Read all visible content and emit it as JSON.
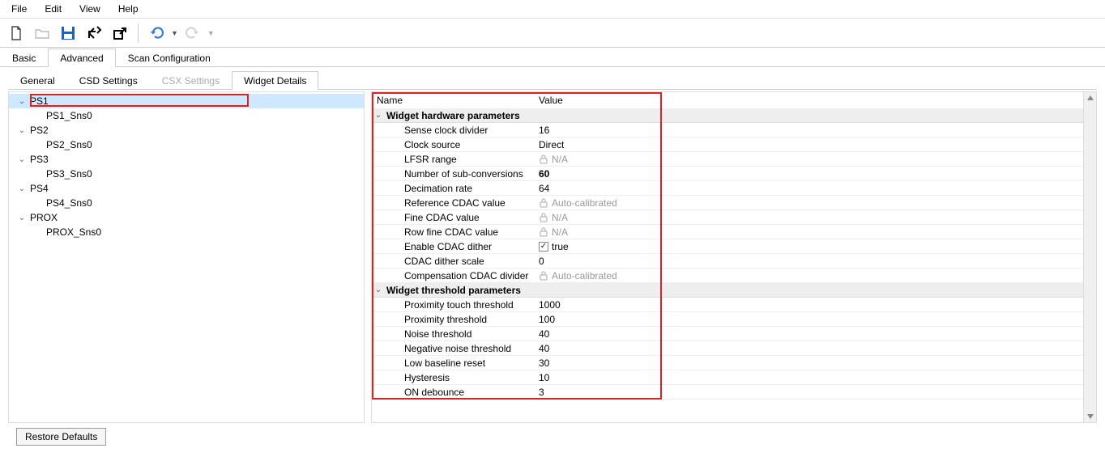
{
  "menu": {
    "file": "File",
    "edit": "Edit",
    "view": "View",
    "help": "Help"
  },
  "tabs1": {
    "basic": "Basic",
    "advanced": "Advanced",
    "scan": "Scan Configuration"
  },
  "tabs2": {
    "general": "General",
    "csd": "CSD Settings",
    "csx": "CSX Settings",
    "widget": "Widget Details"
  },
  "tree": {
    "ps1": "PS1",
    "ps1s": "PS1_Sns0",
    "ps2": "PS2",
    "ps2s": "PS2_Sns0",
    "ps3": "PS3",
    "ps3s": "PS3_Sns0",
    "ps4": "PS4",
    "ps4s": "PS4_Sns0",
    "prox": "PROX",
    "proxs": "PROX_Sns0"
  },
  "propHeader": {
    "name": "Name",
    "value": "Value"
  },
  "groups": {
    "hw": "Widget hardware parameters",
    "th": "Widget threshold parameters"
  },
  "hw": {
    "senseClockDivider": {
      "name": "Sense clock divider",
      "value": "16"
    },
    "clockSource": {
      "name": "Clock source",
      "value": "Direct"
    },
    "lfsrRange": {
      "name": "LFSR range",
      "value": "N/A"
    },
    "numSubConv": {
      "name": "Number of sub-conversions",
      "value": "60"
    },
    "decimationRate": {
      "name": "Decimation rate",
      "value": "64"
    },
    "refCdac": {
      "name": "Reference CDAC value",
      "value": "Auto-calibrated"
    },
    "fineCdac": {
      "name": "Fine CDAC value",
      "value": "N/A"
    },
    "rowFineCdac": {
      "name": "Row fine CDAC value",
      "value": "N/A"
    },
    "enableDither": {
      "name": "Enable CDAC dither",
      "value": "true"
    },
    "ditherScale": {
      "name": "CDAC dither scale",
      "value": "0"
    },
    "compDivider": {
      "name": "Compensation CDAC divider",
      "value": "Auto-calibrated"
    }
  },
  "th": {
    "proxTouch": {
      "name": "Proximity touch threshold",
      "value": "1000"
    },
    "prox": {
      "name": "Proximity threshold",
      "value": "100"
    },
    "noise": {
      "name": "Noise threshold",
      "value": "40"
    },
    "negNoise": {
      "name": "Negative noise threshold",
      "value": "40"
    },
    "lowBaseline": {
      "name": "Low baseline reset",
      "value": "30"
    },
    "hysteresis": {
      "name": "Hysteresis",
      "value": "10"
    },
    "onDebounce": {
      "name": "ON debounce",
      "value": "3"
    }
  },
  "footer": {
    "restore": "Restore Defaults"
  }
}
